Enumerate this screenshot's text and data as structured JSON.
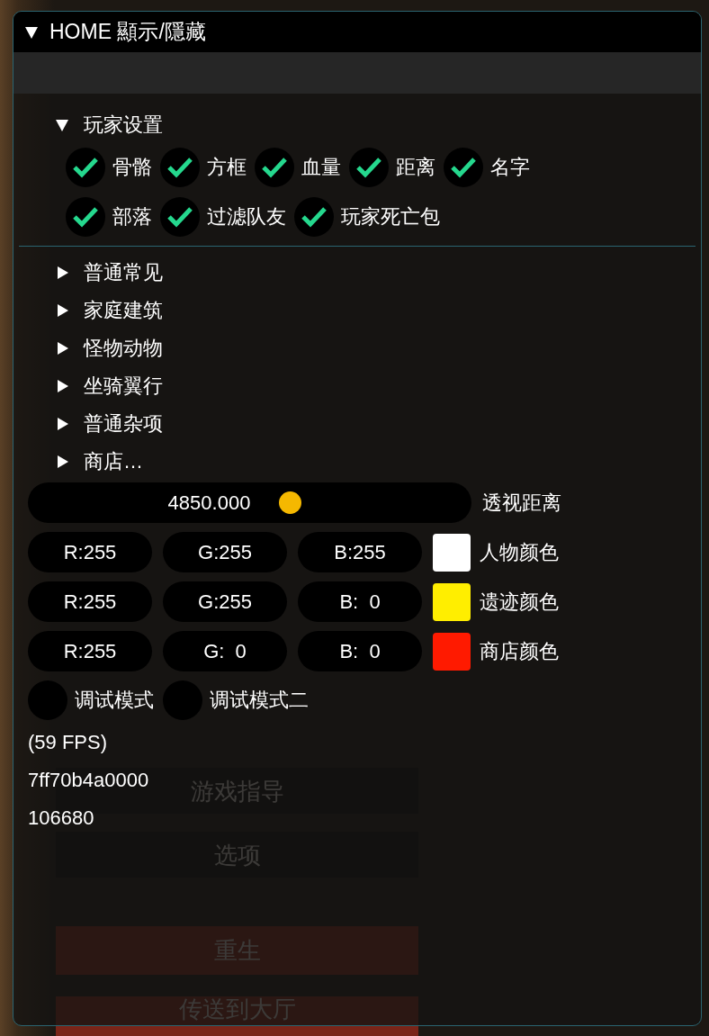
{
  "game_menu": {
    "buttons": [
      {
        "label": "游戏指导",
        "kind": "normal"
      },
      {
        "label": "选项",
        "kind": "normal"
      },
      {
        "label": "重生",
        "kind": "danger"
      },
      {
        "label": "传送到大厅",
        "kind": "danger"
      }
    ]
  },
  "window": {
    "title": "HOME 顯示/隱藏",
    "expanded": true
  },
  "player_settings": {
    "label": "玩家设置",
    "expanded": true,
    "options": [
      {
        "label": "骨骼",
        "checked": true
      },
      {
        "label": "方框",
        "checked": true
      },
      {
        "label": "血量",
        "checked": true
      },
      {
        "label": "距离",
        "checked": true
      },
      {
        "label": "名字",
        "checked": true
      },
      {
        "label": "部落",
        "checked": true
      },
      {
        "label": "过滤队友",
        "checked": true
      },
      {
        "label": "玩家死亡包",
        "checked": true
      }
    ]
  },
  "categories": [
    {
      "label": "普通常见",
      "expanded": false
    },
    {
      "label": "家庭建筑",
      "expanded": false
    },
    {
      "label": "怪物动物",
      "expanded": false
    },
    {
      "label": "坐骑翼行",
      "expanded": false
    },
    {
      "label": "普通杂项",
      "expanded": false
    },
    {
      "label": "商店…",
      "expanded": false
    }
  ],
  "distance_slider": {
    "value": "4850.000",
    "level": 0.59,
    "label": "透视距离"
  },
  "colors": [
    {
      "r": "R:255",
      "g": "G:255",
      "b": "B:255",
      "color": "#ffffff",
      "label": "人物颜色"
    },
    {
      "r": "R:255",
      "g": "G:255",
      "b": "B:  0",
      "color": "#ffee00",
      "label": "遗迹颜色"
    },
    {
      "r": "R:255",
      "g": "G:  0",
      "b": "B:  0",
      "color": "#ff1a00",
      "label": "商店颜色"
    }
  ],
  "debug_options": [
    {
      "label": "调试模式",
      "checked": false
    },
    {
      "label": "调试模式二",
      "checked": false
    }
  ],
  "stats": [
    "(59 FPS)",
    "7ff70b4a0000",
    "106680"
  ]
}
